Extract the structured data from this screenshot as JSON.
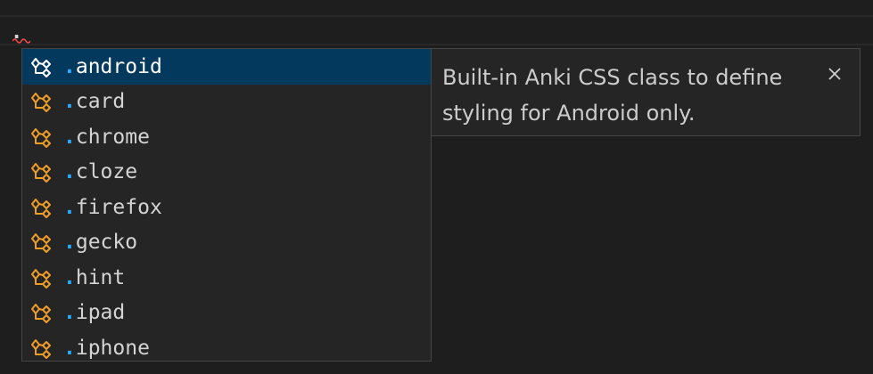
{
  "editor": {
    "typed_text": ".",
    "squiggle_color": "#f14c4c"
  },
  "suggest": {
    "icon_name": "class-icon",
    "icon_color": "#ee9d28",
    "icon_color_selected": "#ffffff",
    "dot_color": "#2aaaff",
    "selected_index": 0,
    "items": [
      {
        "dot": ".",
        "name": "android"
      },
      {
        "dot": ".",
        "name": "card"
      },
      {
        "dot": ".",
        "name": "chrome"
      },
      {
        "dot": ".",
        "name": "cloze"
      },
      {
        "dot": ".",
        "name": "firefox"
      },
      {
        "dot": ".",
        "name": "gecko"
      },
      {
        "dot": ".",
        "name": "hint"
      },
      {
        "dot": ".",
        "name": "ipad"
      },
      {
        "dot": ".",
        "name": "iphone"
      }
    ]
  },
  "details": {
    "description": "Built-in Anki CSS class to define styling for Android only.",
    "close_icon": "close-icon"
  }
}
